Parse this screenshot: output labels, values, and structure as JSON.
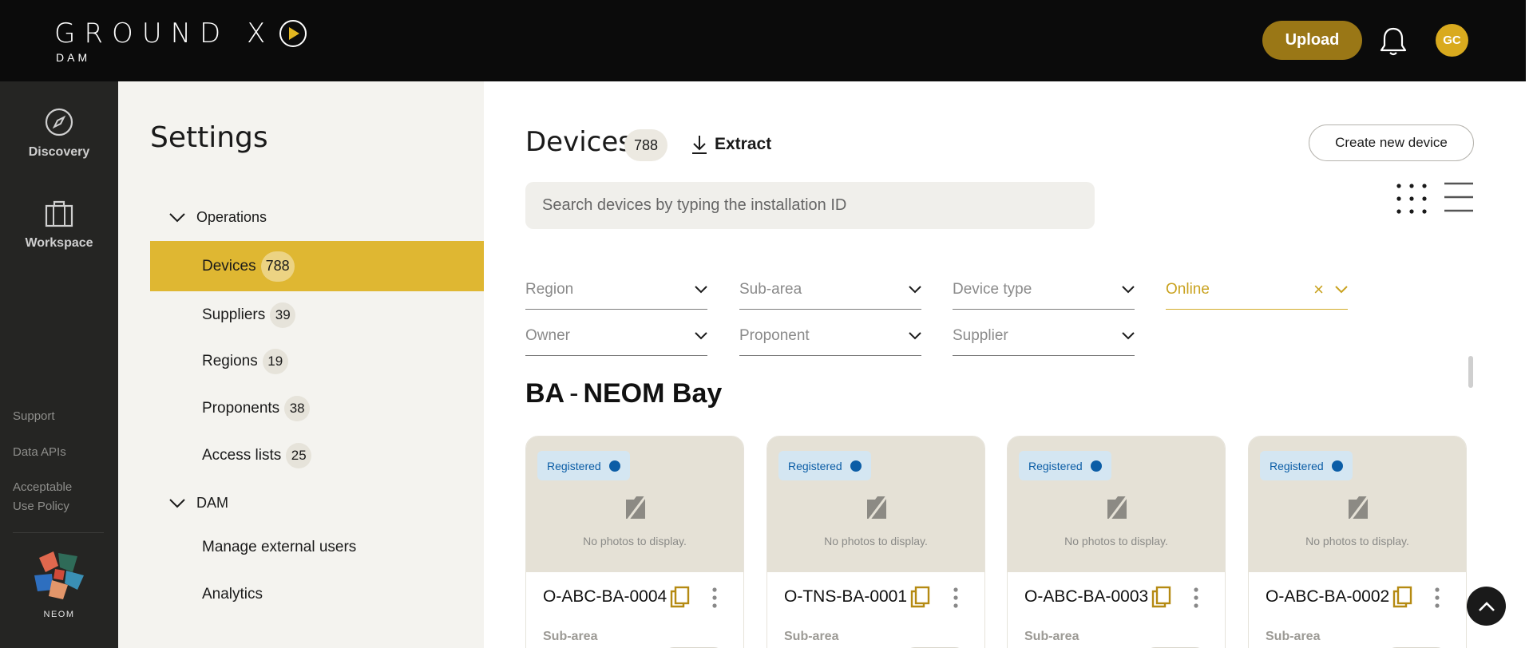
{
  "header": {
    "logo_text": "GROUND X",
    "logo_sub": "DAM",
    "upload_label": "Upload",
    "avatar_initials": "GC",
    "accent_color": "#9a7716"
  },
  "rail": {
    "items": [
      {
        "label": "Discovery",
        "icon": "compass-icon"
      },
      {
        "label": "Workspace",
        "icon": "briefcase-icon"
      }
    ],
    "links": [
      "Support",
      "Data APIs",
      "Acceptable",
      "Use Policy"
    ],
    "brand_label": "NEOM"
  },
  "settings": {
    "title": "Settings",
    "sections": [
      {
        "label": "Operations"
      },
      {
        "label": "DAM"
      }
    ],
    "items": [
      {
        "label": "Devices",
        "count": "788",
        "active": true
      },
      {
        "label": "Suppliers",
        "count": "39"
      },
      {
        "label": "Regions",
        "count": "19"
      },
      {
        "label": "Proponents",
        "count": "38"
      },
      {
        "label": "Access lists",
        "count": "25"
      },
      {
        "label": "Manage external users"
      },
      {
        "label": "Analytics"
      }
    ],
    "active_color": "#dfb732"
  },
  "main": {
    "title": "Devices",
    "count": "788",
    "extract_label": "Extract",
    "create_label": "Create new device",
    "search_placeholder": "Search devices by typing the installation ID",
    "filters": [
      {
        "label": "Region"
      },
      {
        "label": "Sub-area"
      },
      {
        "label": "Device type"
      },
      {
        "label": "Online",
        "active": true
      },
      {
        "label": "Owner"
      },
      {
        "label": "Proponent"
      },
      {
        "label": "Supplier"
      }
    ],
    "filter_clear": "×",
    "group": {
      "code": "BA",
      "dash": "-",
      "name": "NEOM Bay"
    },
    "cards": [
      {
        "status": "Registered",
        "no_photos": "No photos to display.",
        "id": "O-ABC-BA-0004",
        "sub_label": "Sub-area"
      },
      {
        "status": "Registered",
        "no_photos": "No photos to display.",
        "id": "O-TNS-BA-0001",
        "sub_label": "Sub-area"
      },
      {
        "status": "Registered",
        "no_photos": "No photos to display.",
        "id": "O-ABC-BA-0003",
        "sub_label": "Sub-area"
      },
      {
        "status": "Registered",
        "no_photos": "No photos to display.",
        "id": "O-ABC-BA-0002",
        "sub_label": "Sub-area"
      }
    ],
    "status_color": "#0b5da6"
  }
}
